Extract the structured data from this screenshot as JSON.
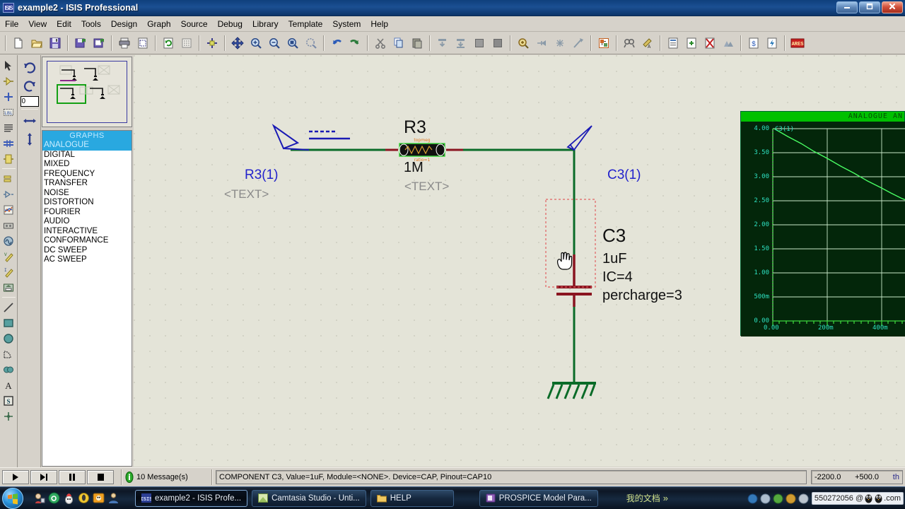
{
  "window": {
    "title": "example2 - ISIS Professional",
    "icon": "isis-icon",
    "controls": {
      "minimize": "—",
      "maximize": "❐",
      "close": "✕"
    }
  },
  "menubar": {
    "items": [
      "File",
      "View",
      "Edit",
      "Tools",
      "Design",
      "Graph",
      "Source",
      "Debug",
      "Library",
      "Template",
      "System",
      "Help"
    ]
  },
  "toolbar": {
    "groups": [
      {
        "buttons": [
          "new-file-icon",
          "open-folder-icon",
          "save-icon"
        ]
      },
      {
        "buttons": [
          "import-section-icon",
          "export-section-icon"
        ]
      },
      {
        "buttons": [
          "print-icon",
          "print-area-icon"
        ]
      },
      {
        "buttons": [
          "refresh-icon",
          "toggle-grid-icon"
        ]
      },
      {
        "buttons": [
          "origin-icon"
        ]
      },
      {
        "buttons": [
          "pan-icon",
          "zoom-in-icon",
          "zoom-out-icon",
          "zoom-all-icon",
          "zoom-area-icon"
        ]
      },
      {
        "buttons": [
          "undo-icon",
          "redo-icon"
        ]
      },
      {
        "buttons": [
          "cut-icon",
          "copy-icon",
          "paste-icon"
        ]
      },
      {
        "buttons": [
          "block-copy-icon",
          "block-move-icon",
          "block-rotate-icon",
          "block-delete-icon"
        ]
      },
      {
        "buttons": [
          "pick-device-icon",
          "make-device-icon",
          "packaging-tool-icon",
          "decompose-icon"
        ]
      },
      {
        "buttons": [
          "toggle-netlist-icon"
        ]
      },
      {
        "buttons": [
          "search-tag-icon",
          "property-assign-icon"
        ]
      },
      {
        "buttons": [
          "new-sheet-icon",
          "remove-sheet-icon",
          "exit-sheet-icon",
          "hierarchy-icon"
        ]
      },
      {
        "buttons": [
          "bom-report-icon",
          "erc-report-icon"
        ]
      },
      {
        "buttons": [
          "ares-icon"
        ]
      }
    ]
  },
  "left_toolbar": {
    "tools": [
      "selection-mode-icon",
      "component-mode-icon",
      "junction-dot-icon",
      "wire-label-icon",
      "text-script-icon",
      "buses-icon",
      "subcircuit-icon",
      "terminals-icon",
      "device-pins-icon",
      "graph-mode-icon",
      "tape-recorder-icon",
      "generator-icon",
      "voltage-probe-icon",
      "current-probe-icon",
      "virtual-instrument-icon",
      "line-tool-icon",
      "box-tool-icon",
      "circle-tool-icon",
      "arc-tool-icon",
      "path-tool-icon",
      "text-tool-icon",
      "symbol-tool-icon",
      "marker-tool-icon"
    ],
    "rotation": {
      "rotate-cw-icon": "rotate-clockwise",
      "rotate-ccw-icon": "rotate-counterclockwise",
      "angle_value": "0",
      "mirror-x-icon": "mirror-horizontal",
      "mirror-y-icon": "mirror-vertical"
    }
  },
  "graphs_panel": {
    "header": "GRAPHS",
    "items": [
      "ANALOGUE",
      "DIGITAL",
      "MIXED",
      "FREQUENCY",
      "TRANSFER",
      "NOISE",
      "DISTORTION",
      "FOURIER",
      "AUDIO",
      "INTERACTIVE",
      "CONFORMANCE",
      "DC SWEEP",
      "AC SWEEP"
    ],
    "selected": "ANALOGUE"
  },
  "schematic": {
    "labels": [
      {
        "name": "probe-label-r3-1",
        "text": "R3(1)",
        "color": "#2222cc",
        "size": 19
      },
      {
        "name": "probe-text-placeholder-left",
        "text": "<TEXT>",
        "color": "#8a8a8a",
        "size": 17
      },
      {
        "name": "resistor-ref",
        "text": "R3",
        "color": "#111111",
        "size": 24
      },
      {
        "name": "resistor-value",
        "text": "1M",
        "color": "#111111",
        "size": 19
      },
      {
        "name": "resistor-text-placeholder",
        "text": "<TEXT>",
        "color": "#8a8a8a",
        "size": 17
      },
      {
        "name": "probe-label-c3-1",
        "text": "C3(1)",
        "color": "#2222cc",
        "size": 19
      },
      {
        "name": "capacitor-ref",
        "text": "C3",
        "color": "#111111",
        "size": 24
      },
      {
        "name": "capacitor-value",
        "text": "1uF",
        "color": "#111111",
        "size": 19
      },
      {
        "name": "capacitor-ic",
        "text": "IC=4",
        "color": "#111111",
        "size": 19
      },
      {
        "name": "capacitor-percharge",
        "text": "percharge=3",
        "color": "#111111",
        "size": 19
      }
    ],
    "colors": {
      "wire": "#0a6b28",
      "component": "#8a1420",
      "probe": "#2222cc",
      "selection": "#e06060",
      "background": "#e4e4d8"
    }
  },
  "graph_window": {
    "title": "ANALOGUE  AN",
    "trace_label": "C3(1)"
  },
  "chart_data": {
    "type": "line",
    "title": "ANALOGUE  AN",
    "xlabel": "",
    "ylabel": "",
    "xticks": [
      "0.00",
      "200m",
      "400m"
    ],
    "xtick_values": [
      0,
      0.2,
      0.4
    ],
    "yticks": [
      "0.00",
      "500m",
      "1.00",
      "1.50",
      "2.00",
      "2.50",
      "3.00",
      "3.50",
      "4.00"
    ],
    "ytick_values": [
      0,
      0.5,
      1.0,
      1.5,
      2.0,
      2.5,
      3.0,
      3.5,
      4.0
    ],
    "xlim": [
      0,
      0.53
    ],
    "ylim": [
      0,
      4.0
    ],
    "grid": true,
    "legend": "C3(1)",
    "series": [
      {
        "name": "C3(1)",
        "x": [
          0.0,
          0.05,
          0.1,
          0.15,
          0.2,
          0.25,
          0.3,
          0.35,
          0.4,
          0.45,
          0.5,
          0.53
        ],
        "values": [
          4.0,
          3.88,
          3.75,
          3.63,
          3.5,
          3.38,
          3.25,
          3.13,
          3.0,
          2.93,
          2.85,
          2.8
        ]
      }
    ],
    "colors": {
      "background": "#03260a",
      "trace": "#4aff64",
      "grid": "#b8e0b8",
      "axis_text": "#2ee0c0",
      "title_bar": "#00c000"
    }
  },
  "statusbar": {
    "animation_buttons": [
      "play-button",
      "step-button",
      "pause-button",
      "stop-button"
    ],
    "messages": "10 Message(s)",
    "component_info": "COMPONENT C3, Value=1uF, Module=<NONE>. Device=CAP, Pinout=CAP10",
    "coord_x": "-2200.0",
    "coord_y": "+500.0",
    "coord_unit": "th"
  },
  "taskbar": {
    "start": "start-orb",
    "quicklaunch": [
      "ql-icon-1",
      "ql-icon-2",
      "ql-icon-3",
      "ql-icon-4",
      "ql-icon-5",
      "ql-icon-6"
    ],
    "tasks": [
      {
        "label": "example2 - ISIS Profe...",
        "icon": "isis-icon",
        "active": true
      },
      {
        "label": "Camtasia Studio - Unti...",
        "icon": "camtasia-icon",
        "active": false
      },
      {
        "label": "HELP",
        "icon": "folder-icon",
        "active": false
      },
      {
        "label": "PROSPICE Model Para...",
        "icon": "prospice-icon",
        "active": false
      }
    ],
    "language_bar": "我的文档",
    "language_chevron": "»",
    "tray_qq": "550272056 @",
    "tray_qq_suffix": ".com"
  }
}
